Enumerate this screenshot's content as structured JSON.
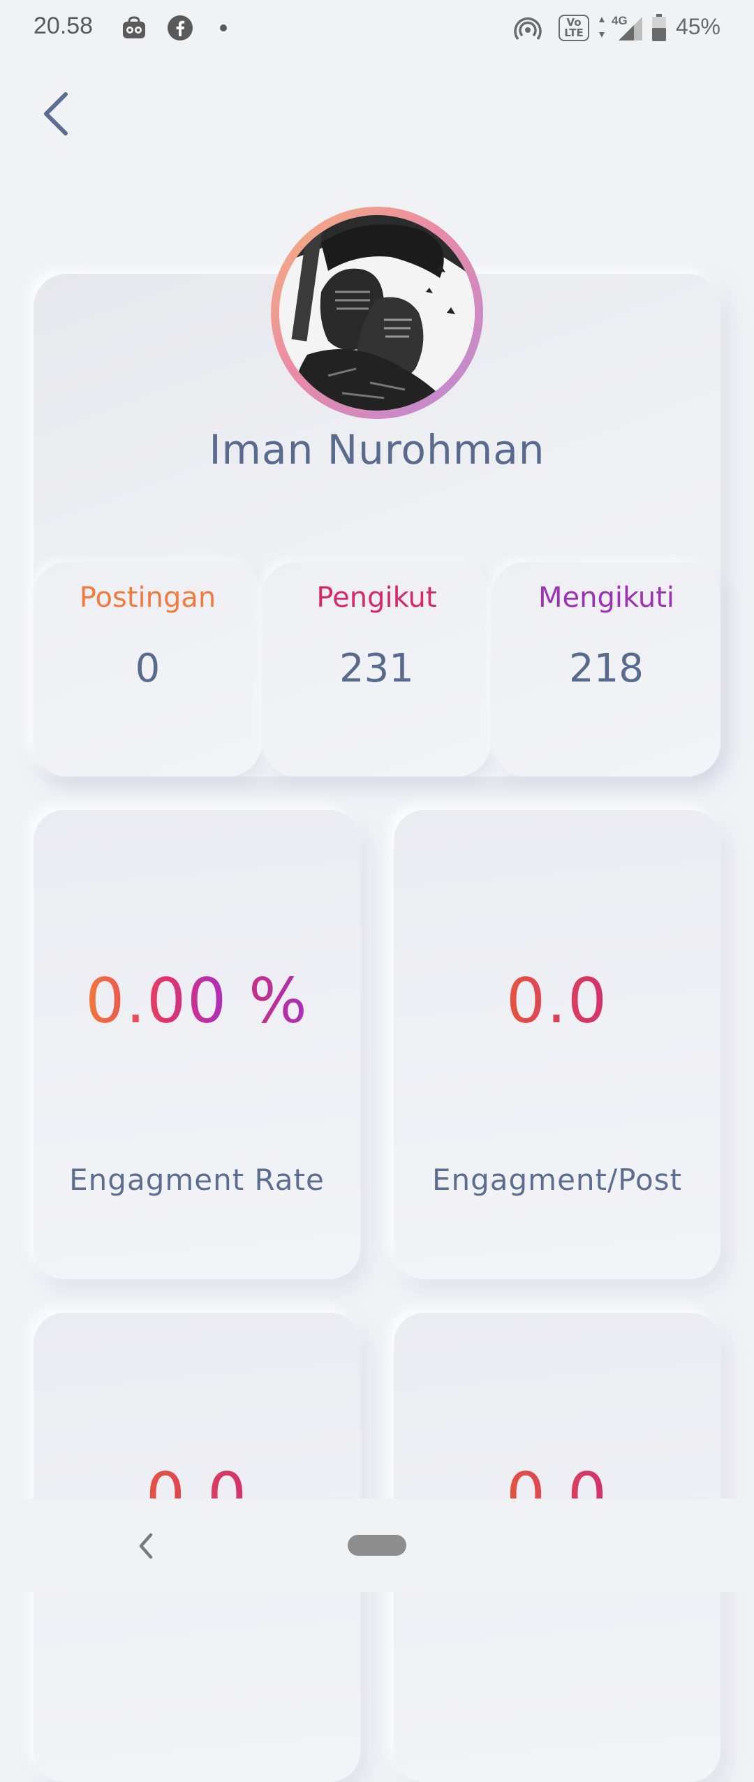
{
  "status_bar": {
    "time": "20.58",
    "battery": "45%",
    "network": "4G",
    "volte": "Vo LTE",
    "icons": [
      "notification-app-icon",
      "facebook-icon",
      "dot-icon",
      "hotspot-icon",
      "volte-icon",
      "signal-icon",
      "battery-icon"
    ]
  },
  "header": {
    "back_icon": "chevron-left-icon"
  },
  "profile": {
    "name": "Iman Nurohman",
    "avatar": "armored-knight-manga-avatar",
    "stats": [
      {
        "label": "Postingan",
        "value": "0",
        "color": "#f07b3f"
      },
      {
        "label": "Pengikut",
        "value": "231",
        "color": "#d42a6b"
      },
      {
        "label": "Mengikuti",
        "value": "218",
        "color": "#9b32b4"
      }
    ]
  },
  "metrics": [
    {
      "value": "0.00",
      "unit": "%",
      "label": "Engagment Rate"
    },
    {
      "value": "0.0",
      "label": "Engagment/Post"
    },
    {
      "value": "0.0"
    },
    {
      "value": "0.0"
    }
  ],
  "colors": {
    "background": "#f1f2f6",
    "text": "#586b8c",
    "gradient_start": "#f27a3a",
    "gradient_mid": "#e0356b",
    "gradient_end": "#a72fc0"
  },
  "nav_bar": {
    "icons": [
      "back-nav-icon",
      "home-pill-icon"
    ]
  }
}
